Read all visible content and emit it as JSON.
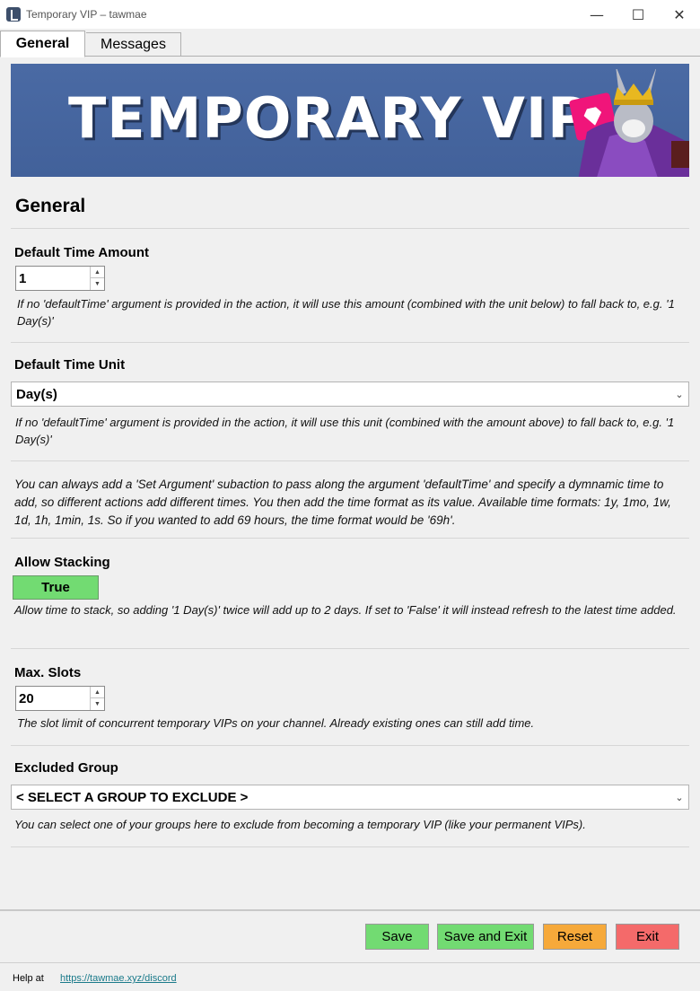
{
  "window": {
    "title": "Temporary VIP – tawmae",
    "minimize": "—",
    "maximize": "☐",
    "close": "✕"
  },
  "tabs": [
    {
      "label": "General",
      "selected": true
    },
    {
      "label": "Messages",
      "selected": false
    }
  ],
  "banner": {
    "text": "TEMPORARY VIP"
  },
  "section": {
    "title": "General"
  },
  "default_time_amount": {
    "label": "Default Time Amount",
    "value": "1",
    "desc": "If no 'defaultTime' argument is provided in the action, it will use this amount (combined with the unit below) to fall back to, e.g. '1 Day(s)'"
  },
  "default_time_unit": {
    "label": "Default Time Unit",
    "value": "Day(s)",
    "desc": "If no 'defaultTime' argument is provided in the action, it will use this unit (combined with the amount above) to fall back to, e.g. '1 Day(s)'"
  },
  "info_note": "You can always add a 'Set Argument' subaction to pass along the argument 'defaultTime' and specify a dymnamic time to add, so different actions add different times. You then add the time format as its value. Available time formats: 1y, 1mo, 1w, 1d, 1h, 1min, 1s. So if you wanted to add 69 hours, the time format would be '69h'.",
  "allow_stacking": {
    "label": "Allow Stacking",
    "value": "True",
    "desc": "Allow time to stack, so adding '1 Day(s)' twice will add up to 2 days. If set to 'False' it will instead refresh to the latest time added."
  },
  "max_slots": {
    "label": "Max. Slots",
    "value": "20",
    "desc": "The slot limit of concurrent temporary VIPs on your channel. Already existing ones can still add time."
  },
  "excluded_group": {
    "label": "Excluded Group",
    "value": "< SELECT A GROUP TO EXCLUDE >",
    "desc": "You can select one of your groups here to exclude from becoming a temporary VIP (like your permanent VIPs)."
  },
  "buttons": {
    "save": "Save",
    "save_exit": "Save and Exit",
    "reset": "Reset",
    "exit": "Exit"
  },
  "help": {
    "text": "Help at",
    "link": "https://tawmae.xyz/discord"
  },
  "colors": {
    "green": "#72db72",
    "orange": "#f6a93a",
    "red": "#f46a6a",
    "banner": "#4a6aa4",
    "pink": "#f0157a"
  }
}
